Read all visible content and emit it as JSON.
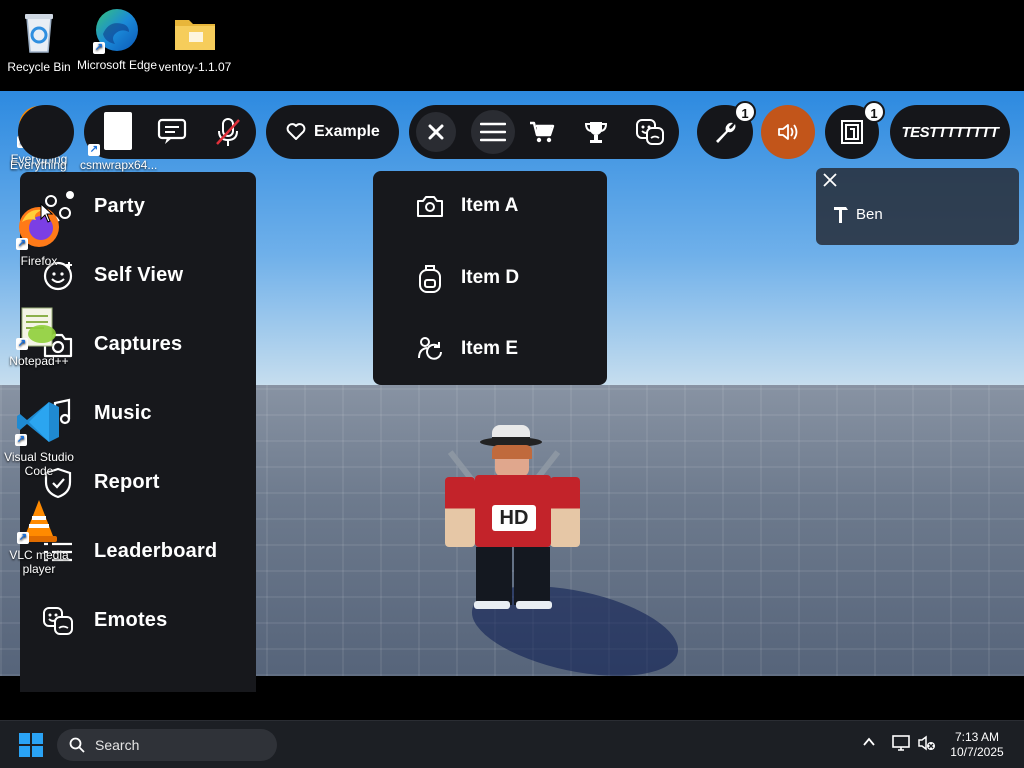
{
  "desktop": {
    "icons_top": [
      {
        "name": "recycle-bin",
        "label": "Recycle Bin"
      },
      {
        "name": "microsoft-edge",
        "label": "Microsoft Edge"
      },
      {
        "name": "ventoy-folder",
        "label": "ventoy-1.1.07"
      }
    ],
    "icons_side": [
      {
        "label": "Everything"
      },
      {
        "label": "csmwrapx64..."
      },
      {
        "label": "Firefox"
      },
      {
        "label": "Notepad++"
      },
      {
        "label": "Visual Studio Code"
      },
      {
        "label": "VLC media player"
      }
    ]
  },
  "topbar": {
    "example_label": "Example",
    "tools_badge": "1",
    "inventory_badge": "1",
    "username": "TESTTTTTTTT"
  },
  "menu": {
    "items": [
      {
        "label": "Party",
        "icon": "party-icon"
      },
      {
        "label": "Self View",
        "icon": "self-view-icon"
      },
      {
        "label": "Captures",
        "icon": "camera-icon"
      },
      {
        "label": "Music",
        "icon": "music-icon"
      },
      {
        "label": "Report",
        "icon": "shield-icon"
      },
      {
        "label": "Leaderboard",
        "icon": "leaderboard-icon"
      },
      {
        "label": "Emotes",
        "icon": "emotes-icon"
      }
    ]
  },
  "dropdown": {
    "items": [
      {
        "label": "Item A",
        "icon": "camera-icon"
      },
      {
        "label": "Item D",
        "icon": "backpack-icon"
      },
      {
        "label": "Item E",
        "icon": "refresh-person-icon"
      }
    ]
  },
  "notification": {
    "name": "Ben"
  },
  "taskbar": {
    "search_placeholder": "Search",
    "time": "7:13 AM",
    "date": "10/7/2025"
  },
  "colors": {
    "panel": "#17181c",
    "accent_orange": "#c2551a",
    "sky": "#4a9de6",
    "floor": "#6d7a8d"
  }
}
